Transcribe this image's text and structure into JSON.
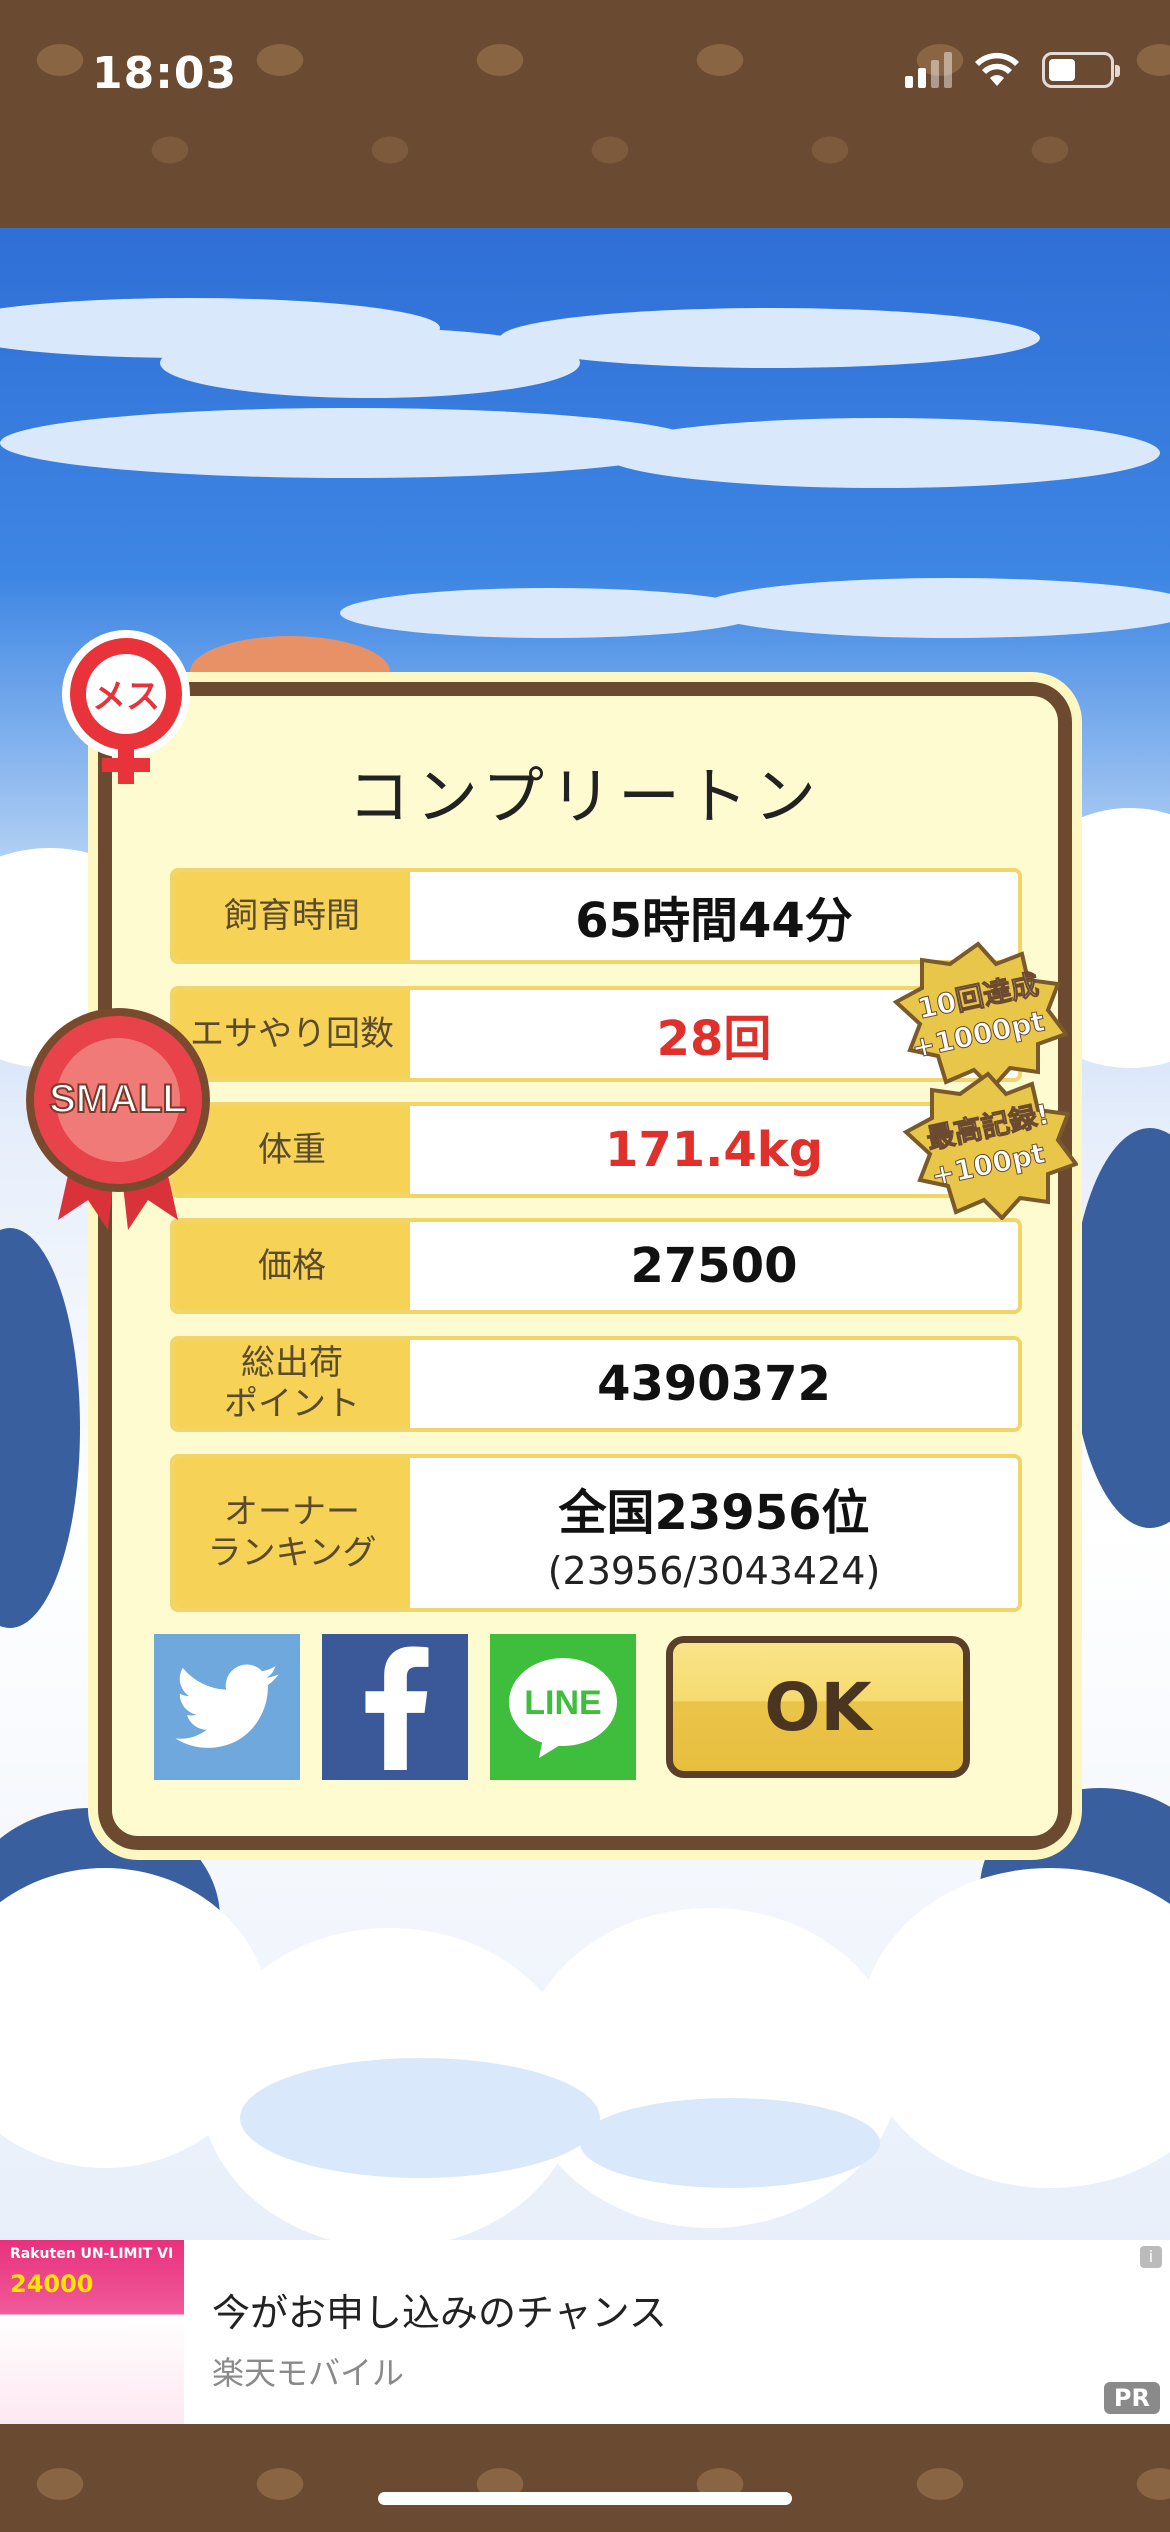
{
  "status_bar": {
    "time": "18:03"
  },
  "dialog": {
    "title": "コンプリートン",
    "rows": [
      {
        "label": "飼育時間",
        "value": "65時間44分"
      },
      {
        "label": "エサやり回数",
        "value": "28回"
      },
      {
        "label": "体重",
        "value": "171.4kg"
      },
      {
        "label": "価格",
        "value": "27500"
      },
      {
        "label": "総出荷\nポイント",
        "value": "4390372"
      },
      {
        "label": "オーナー\nランキング",
        "value": "全国23956位",
        "sub": "(23956/3043424)"
      }
    ],
    "ok_label": "OK",
    "share": {
      "line_label": "LINE"
    }
  },
  "badges": {
    "female": "メス",
    "size": "SMALL",
    "bonus1": {
      "line1": "10回達成",
      "line2": "+1000pt"
    },
    "bonus2": {
      "line1": "最高記録!",
      "line2": "+100pt"
    }
  },
  "ad": {
    "title": "今がお申し込みのチャンス",
    "source": "楽天モバイル",
    "pr": "PR",
    "info": "i",
    "thumb_line1": "Rakuten UN-LIMIT VI",
    "thumb_line2": "24000"
  },
  "colors": {
    "accent_red": "#e0302c",
    "label_yellow": "#f6d356",
    "frame_brown": "#6b4a2f"
  }
}
